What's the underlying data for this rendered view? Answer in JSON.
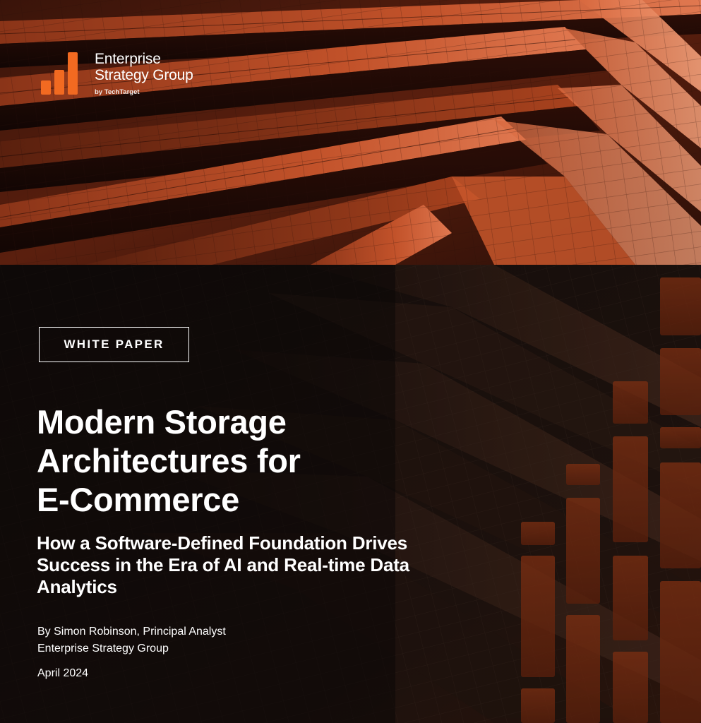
{
  "logo": {
    "line1": "Enterprise",
    "line2": "Strategy Group",
    "by": "by TechTarget",
    "icon": "bar-chart-logo-icon"
  },
  "badge": "WHITE PAPER",
  "title": {
    "line1": "Modern Storage",
    "line2": "Architectures for",
    "line3": "E-Commerce"
  },
  "subtitle": {
    "line1": "How a Software-Defined Foundation Drives",
    "line2": "Success in the Era of AI and Real-time Data",
    "line3": "Analytics"
  },
  "byline": {
    "author": "By Simon Robinson, Principal Analyst",
    "org": "Enterprise Strategy Group"
  },
  "date": "April 2024",
  "colors": {
    "accent_orange": "#f26a21",
    "building_rust": "#b34420",
    "background_dark": "#0e0a09",
    "text": "#ffffff"
  }
}
